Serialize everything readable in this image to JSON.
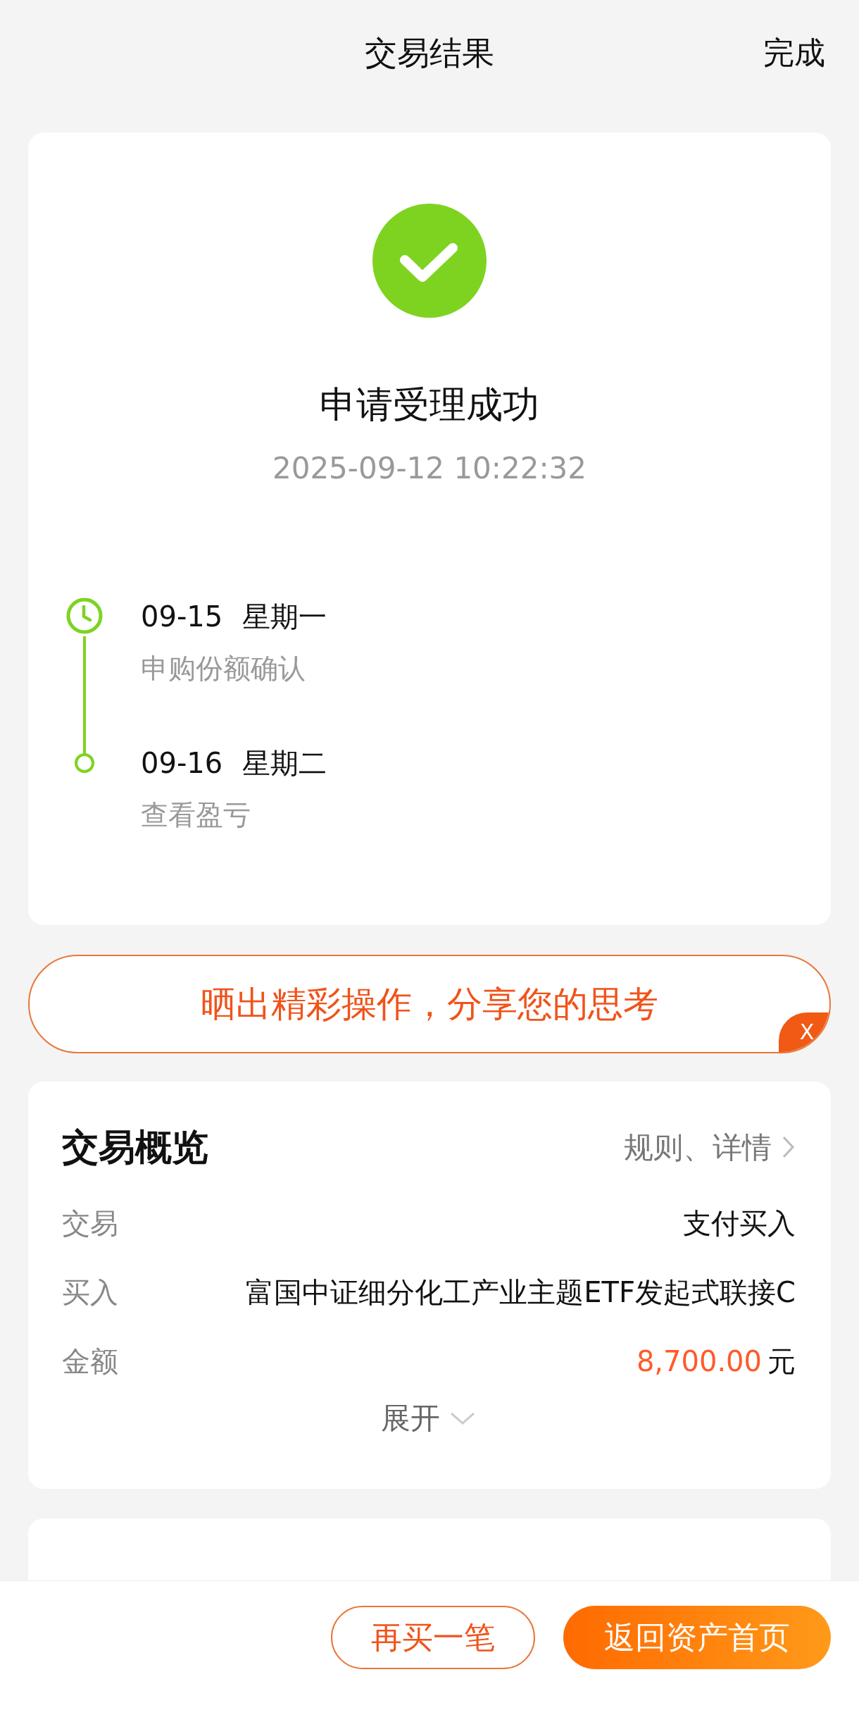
{
  "header": {
    "title": "交易结果",
    "done": "完成"
  },
  "result": {
    "status": "申请受理成功",
    "time": "2025-09-12  10:22:32"
  },
  "timeline": [
    {
      "kind": "clock",
      "date": "09-15",
      "weekday": "星期一",
      "note": "申购份额确认"
    },
    {
      "kind": "dot",
      "date": "09-16",
      "weekday": "星期二",
      "note": "查看盈亏"
    }
  ],
  "share": {
    "text": "晒出精彩操作，分享您的思考",
    "close": "X"
  },
  "overview": {
    "title": "交易概览",
    "link": "规则、详情",
    "rows": [
      {
        "kind": "plain",
        "label": "交易",
        "value": "支付买入"
      },
      {
        "kind": "name",
        "label": "买入",
        "value": "富国中证细分化工产业主题ETF发起式联接C"
      },
      {
        "kind": "amount",
        "label": "金额",
        "value": "8,700.00",
        "unit": "元"
      }
    ],
    "expand": "展开"
  },
  "buttons": [
    {
      "kind": "outline",
      "label": "再买一笔"
    },
    {
      "kind": "primary",
      "label": "返回资产首页"
    }
  ]
}
